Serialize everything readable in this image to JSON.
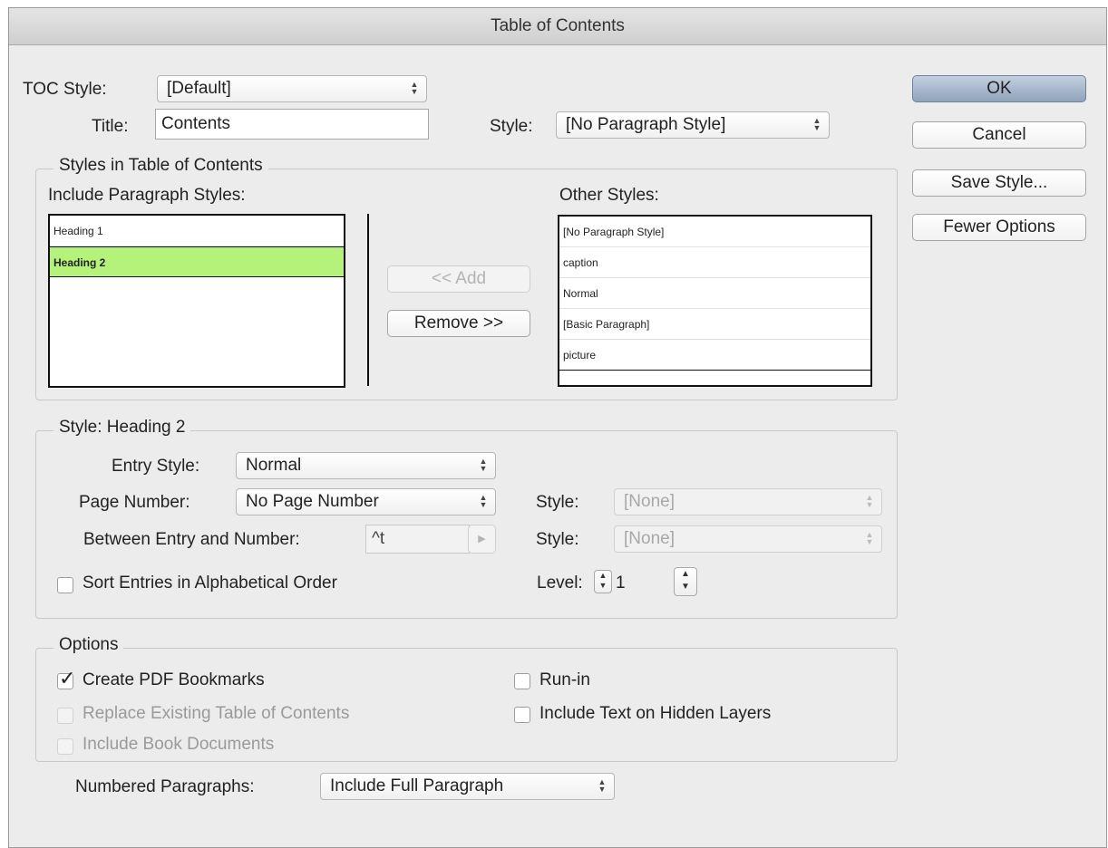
{
  "window": {
    "title": "Table of Contents"
  },
  "header": {
    "toc_style_label": "TOC Style:",
    "toc_style_value": "[Default]",
    "title_label": "Title:",
    "title_value": "Contents",
    "style_label": "Style:",
    "style_value": "[No Paragraph Style]"
  },
  "buttons": {
    "ok": "OK",
    "cancel": "Cancel",
    "save_style": "Save Style...",
    "fewer_options": "Fewer Options",
    "add": "<< Add",
    "remove": "Remove >>"
  },
  "styles_in_toc": {
    "group_title": "Styles in Table of Contents",
    "include_label": "Include Paragraph Styles:",
    "include_items": [
      "Heading 1",
      "Heading 2"
    ],
    "selected_item": "Heading 2",
    "other_label": "Other Styles:",
    "other_items": [
      "[No Paragraph Style]",
      "caption",
      "Normal",
      "[Basic Paragraph]",
      "picture"
    ]
  },
  "style_section": {
    "group_title": "Style: Heading 2",
    "entry_style_label": "Entry Style:",
    "entry_style_value": "Normal",
    "page_number_label": "Page Number:",
    "page_number_value": "No Page Number",
    "between_label": "Between Entry and Number:",
    "between_value": "^t",
    "page_style_label": "Style:",
    "page_style_value": "[None]",
    "between_style_label": "Style:",
    "between_style_value": "[None]",
    "sort_label": "Sort Entries in Alphabetical Order",
    "sort_checked": false,
    "level_label": "Level:",
    "level_value": "1"
  },
  "options": {
    "group_title": "Options",
    "create_pdf_bookmarks": {
      "label": "Create PDF Bookmarks",
      "checked": true
    },
    "replace_existing": {
      "label": "Replace Existing Table of Contents",
      "checked": false,
      "enabled": false
    },
    "include_book_docs": {
      "label": "Include Book Documents",
      "checked": false,
      "enabled": false
    },
    "run_in": {
      "label": "Run-in",
      "checked": false
    },
    "include_hidden_layers": {
      "label": "Include Text on Hidden Layers",
      "checked": false
    },
    "numbered_paragraphs_label": "Numbered Paragraphs:",
    "numbered_paragraphs_value": "Include Full Paragraph"
  },
  "icons": {
    "popup_arrows": "up-down-arrows-icon",
    "checkmark": "checkmark-icon",
    "menu_arrow": "triangle-right-icon"
  }
}
